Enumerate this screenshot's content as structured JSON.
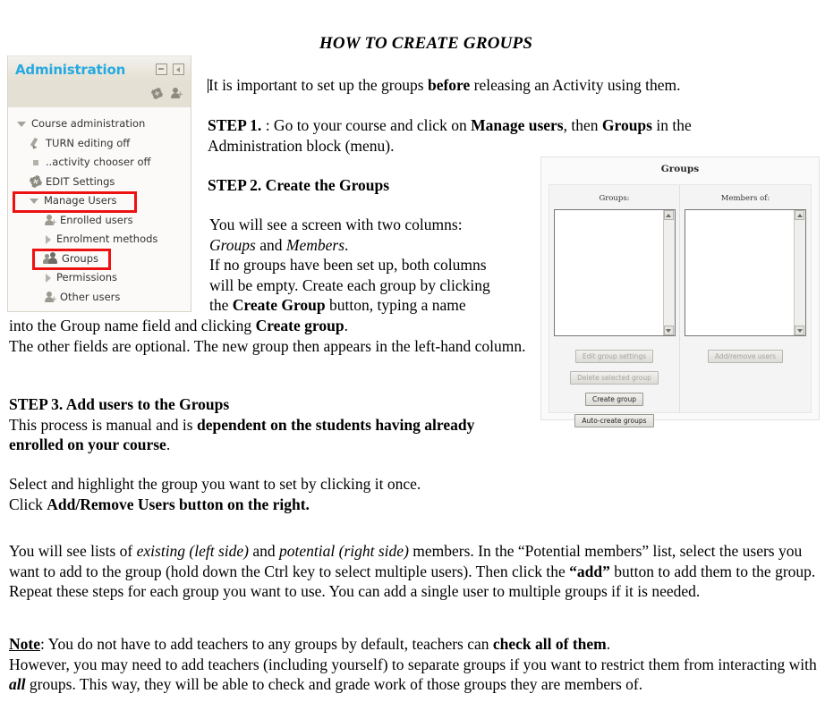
{
  "document": {
    "title": "HOW TO CREATE GROUPS"
  },
  "admin_block": {
    "header_title": "Administration",
    "header_icons": [
      {
        "name": "collapse-icon",
        "glyph": "minus-square"
      },
      {
        "name": "dock-icon",
        "glyph": "left-arrow-square"
      }
    ],
    "subbar_icons": [
      {
        "name": "gear-icon"
      },
      {
        "name": "add-user-icon"
      }
    ],
    "tree": [
      {
        "label": "Course administration",
        "icon": "caret-down-icon",
        "indent": 0,
        "highlight": false
      },
      {
        "label": "TURN editing off",
        "icon": "pencil-icon",
        "indent": 1,
        "highlight": false
      },
      {
        "label": "..activity chooser off",
        "icon": "square-bullet-icon",
        "indent": 1,
        "highlight": false
      },
      {
        "label": "EDIT Settings",
        "icon": "gear-icon",
        "indent": 1,
        "highlight": false
      },
      {
        "label": "Manage Users",
        "icon": "caret-down-icon",
        "indent": 1,
        "highlight": true
      },
      {
        "label": "Enrolled users",
        "icon": "person-add-icon",
        "indent": 2,
        "highlight": false
      },
      {
        "label": "Enrolment methods",
        "icon": "caret-right-icon",
        "indent": 2,
        "highlight": false
      },
      {
        "label": "Groups",
        "icon": "people-icon",
        "indent": 2,
        "highlight": true
      },
      {
        "label": "Permissions",
        "icon": "caret-right-icon",
        "indent": 2,
        "highlight": false
      },
      {
        "label": "Other users",
        "icon": "person-add-icon",
        "indent": 2,
        "highlight": false
      }
    ],
    "colors": {
      "title": "#26a9e0",
      "header_bg": "#e7e3d7",
      "highlight_box": "#ee1111"
    }
  },
  "groups_panel": {
    "title": "Groups",
    "left_column": {
      "label": "Groups:",
      "listbox_items": [],
      "buttons": [
        {
          "label": "Edit group settings",
          "disabled": true
        },
        {
          "label": "Delete selected group",
          "disabled": true
        },
        {
          "label": "Create group",
          "disabled": false
        },
        {
          "label": "Auto-create groups",
          "disabled": false
        }
      ]
    },
    "right_column": {
      "label": "Members of:",
      "listbox_items": [],
      "buttons": [
        {
          "label": "Add/remove users",
          "disabled": true
        }
      ]
    }
  },
  "body_text": {
    "intro_a": "It is important to set up the groups ",
    "intro_b": "before",
    "intro_c": " releasing an Activity using them.",
    "step1_label": "STEP 1.",
    "step1_a": " : Go to your course and click on ",
    "step1_b": "Manage users",
    "step1_c": ", then ",
    "step1_d": "Groups",
    "step1_e": " in the Administration block (menu).",
    "step2_heading": "STEP 2. Create the Groups",
    "col_l1": "You will see a screen with two columns:",
    "col_l2a": "Groups",
    "col_l2b": " and ",
    "col_l2c": "Members",
    "col_l2d": ".",
    "col_l3": "If no groups have been set up, both columns",
    "col_l4": "will be empty. Create each group by clicking",
    "col_l5a": "the ",
    "col_l5b": "Create Group",
    "col_l5c": " button, typing a name",
    "after_a": "into the Group name field and clicking ",
    "after_b": "Create group",
    "after_c": ".",
    "after_d": "The other fields are optional. The new group then appears in the left-hand column.",
    "step3_heading": "STEP 3. Add users to the Groups",
    "step3_a": "This process is manual and is ",
    "step3_b": "dependent on the students having already enrolled on your course",
    "step3_c": ".",
    "select_l1": "Select and highlight the group you want to set by clicking it once.",
    "select_l2a": "Click ",
    "select_l2b": "Add/Remove Users button on the right.",
    "lists_a": "You will see lists of ",
    "lists_b": "existing (left side)",
    "lists_c": " and ",
    "lists_d": "potential (right side)",
    "lists_e": " members.  In the “Potential members” list, select the users you want to add to the group (hold down the Ctrl key to select multiple users). Then click the ",
    "lists_f": "“add”",
    "lists_g": " button to add them to the group. Repeat these steps for each group you want to use. You can add a single user to multiple groups if it is needed.",
    "note_label": "Note",
    "note_a": ":  You do not have to add teachers to any groups by default, teachers can ",
    "note_b": "check all of them",
    "note_c": ".",
    "note_d": "However, you may need to add teachers (including yourself) to separate groups if you want to restrict them from interacting with ",
    "note_e": "all",
    "note_f": " groups. This way, they will be able to check and grade work of those groups they are members of."
  }
}
